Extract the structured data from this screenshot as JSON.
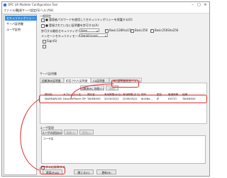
{
  "window": {
    "title": "OPC UA Modeler Configuration Tool",
    "controls": [
      "–",
      "□",
      "✕"
    ]
  },
  "menu": [
    "ファイル(F)",
    "拡張サーバ設定(S)",
    "ヘルプ(H)"
  ],
  "sidebar": {
    "items": [
      {
        "label": "セキュリティポリシー"
      },
      {
        "label": "サーバ証明書"
      },
      {
        "label": "ユーザ証明"
      }
    ]
  },
  "general": {
    "section_title": "一般設定",
    "checkbox1_label": "■ 管理者パスワードを使用してセキュリティポリシーを保護する(U)",
    "checkbox2_label": "■ 登録されていない証明書を許可する(A)",
    "min_policy_label": "許可する最低セキュリティポリシー",
    "min_policy_value": "None",
    "policies": [
      {
        "label": "Basic128Rsa15",
        "checked": true
      },
      {
        "label": "Basic256",
        "checked": true
      },
      {
        "label": "Basic256Sha256",
        "checked": true
      }
    ],
    "message_mode_label": "メッセージセキュリティモード",
    "message_mode_value": "Sign&Encrypt",
    "extra_label": "Sign(S)"
  },
  "certs": {
    "section_title": "サーバ証明書",
    "tabs": [
      "信頼済み証明書",
      "拒否された証明書",
      "CA証明書",
      "CRL(証明書失効リスト)"
    ],
    "active_tab": 1,
    "trust_button": "信頼済みに移動(T)",
    "remove_button": "削除",
    "columns": [
      "発行先",
      "サブジェクト名",
      "発行者",
      "有効期限(から)",
      "有効期限(まで)",
      "拇印",
      "国名",
      "都道府県",
      "組織"
    ],
    "rows": [
      [
        "MAMMARC0BF",
        "DeviceXPlorer OPC Serv...",
        "TAKEBISHI",
        "2019/05/22",
        "2039/05/22",
        "6c4f8a...",
        "JP",
        "KYOTO",
        "TAKEBISHI"
      ]
    ]
  },
  "users": {
    "section_title": "ユーザ管理",
    "add_button": "ユーザの追加(D)",
    "edit_button": "編集(E)",
    "delete_button": "削除(L)",
    "list_header": "ユーザ名"
  },
  "footer": {
    "checkbox_label": "すぐに反映する",
    "apply_button": "適用(P)(A)",
    "close_button": "閉じる(C)",
    "reload_button": "更新(R)"
  },
  "accent": {
    "selection": "#3c8ee0",
    "highlight": "#e03030"
  }
}
